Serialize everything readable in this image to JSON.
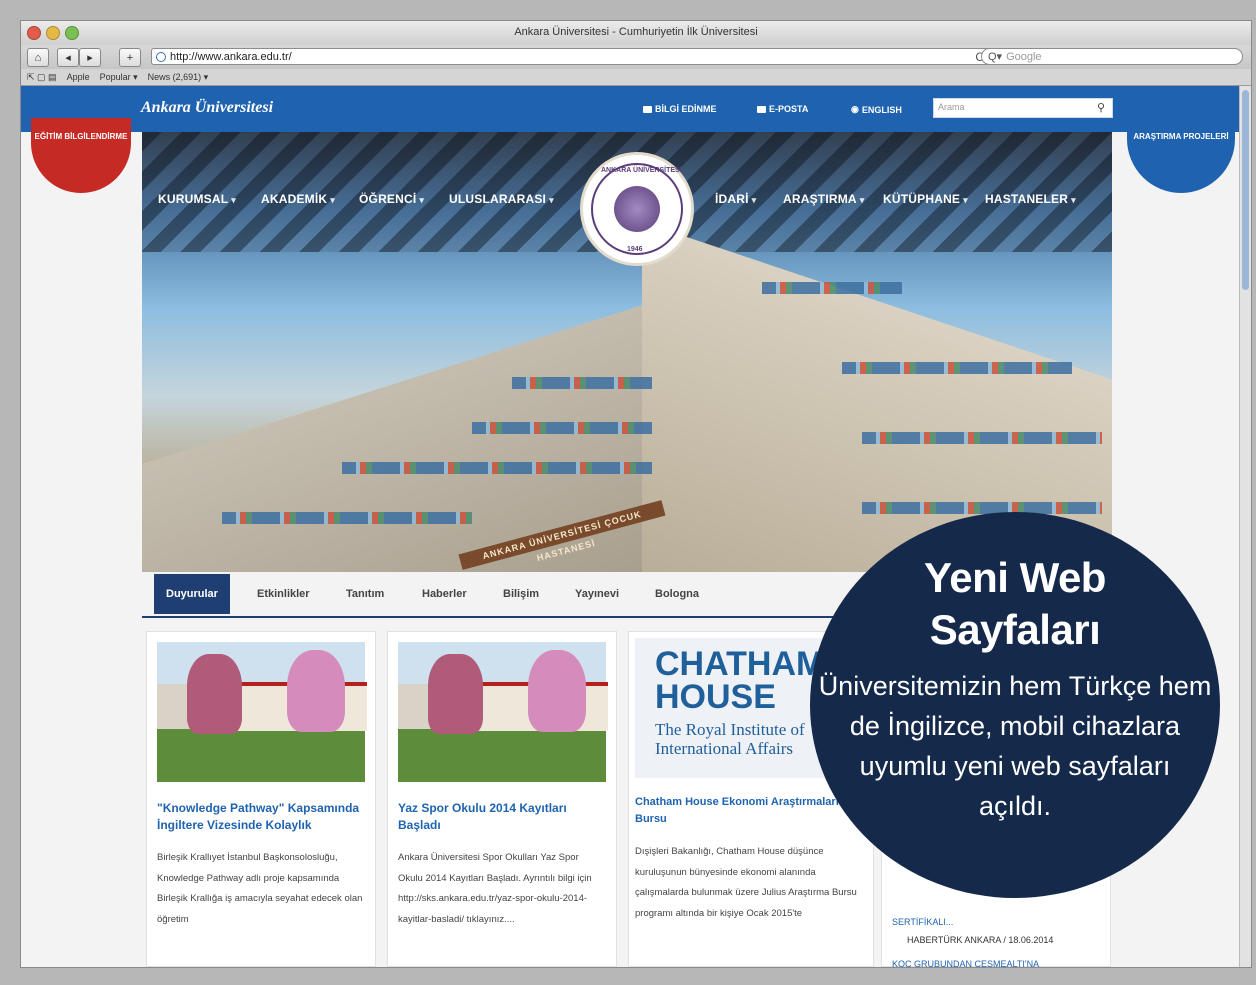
{
  "browser": {
    "window_title": "Ankara Üniversitesi - Cumhuriyetin İlk Üniversitesi",
    "url": "http://www.ankara.edu.tr/",
    "search_placeholder": "Google",
    "bookmarks": [
      "Apple",
      "Popular ▾",
      "News (2,691) ▾"
    ]
  },
  "site": {
    "logo": "Ankara Üniversitesi",
    "top_links": [
      "BİLGİ EDİNME",
      "E-POSTA",
      "ENGLISH"
    ],
    "search_placeholder": "Arama",
    "left_tab": "EĞİTİM BİLGİLENDİRME",
    "right_tab": "ARAŞTIRMA PROJELERİ",
    "nav": [
      "KURUMSAL",
      "AKADEMİK",
      "ÖĞRENCİ",
      "ULUSLARARASI",
      "İDARİ",
      "ARAŞTIRMA",
      "KÜTÜPHANE",
      "HASTANELER"
    ],
    "seal_top": "ANKARA ÜNİVERSİTESİ",
    "seal_year": "1946",
    "building_sign": "ANKARA ÜNİVERSİTESİ ÇOCUK HASTANESİ"
  },
  "tabs": [
    "Duyurular",
    "Etkinlikler",
    "Tanıtım",
    "Haberler",
    "Bilişim",
    "Yayınevi",
    "Bologna"
  ],
  "cards": [
    {
      "title": "\"Knowledge Pathway\" Kapsamında İngiltere Vizesinde Kolaylık",
      "body": "Birleşik Krallıyet İstanbul Başkonsolosluğu, Knowledge Pathway adlı proje kapsamında Birleşik Krallığa iş amacıyla seyahat edecek olan öğretim"
    },
    {
      "title": "Yaz Spor Okulu 2014 Kayıtları Başladı",
      "body": "Ankara Üniversitesi Spor Okulları Yaz Spor Okulu 2014 Kayıtları Başladı. Ayrıntılı bilgi için http://sks.ankara.edu.tr/yaz-spor-okulu-2014-kayitlar-basladi/ tıklayınız...."
    },
    {
      "image_line1": "CHATHAM",
      "image_line2": "HOUSE",
      "image_line3": "The Royal Institute of",
      "image_line4": "International Affairs",
      "title": "Chatham House Ekonomi Araştırmaları Bursu",
      "body": "Dışişleri Bakanlığı, Chatham House düşünce kuruluşunun bünyesinde ekonomi alanında çalışmalarda bulunmak üzere Julius Araştırma Bursu programı altında bir kişiye Ocak 2015'te"
    }
  ],
  "news_side": {
    "item1": "SERTİFİKALI...",
    "item1_source": "HABERTÜRK ANKARA / 18.06.2014",
    "item2": "KOÇ GRUBUNDAN ÇEŞMEALTI'NA"
  },
  "promo": {
    "title_line1": "Yeni Web",
    "title_line2": "Sayfaları",
    "body_lines": [
      "Üniversitemizin hem Türkçe hem",
      "de İngilizce, mobil cihazlara",
      "uyumlu yeni web sayfaları",
      "açıldı."
    ]
  }
}
